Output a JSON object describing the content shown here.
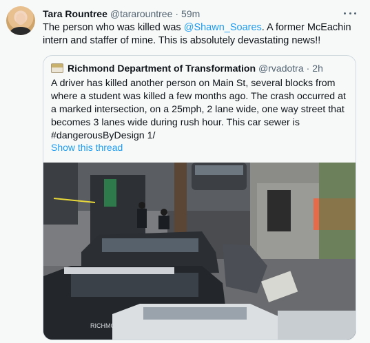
{
  "tweet": {
    "author_name": "Tara Rountree",
    "handle": "@tararountree",
    "separator": "·",
    "time": "59m",
    "text_before": "The person who was killed was ",
    "mention": "@Shawn_Soares",
    "text_after": ". A former McEachin intern and staffer of mine. This is absolutely devastating news!!"
  },
  "quoted": {
    "author_name": "Richmond Department of Transformation",
    "handle": "@rvadotra",
    "separator": "·",
    "time": "2h",
    "text": "A driver has killed another person on Main St, several blocks from where a student was killed a few months ago. The crash occurred at a marked intersection, on a 25mph, 2 lane wide, one way street that becomes 3 lanes wide during rush hour. This car sewer is #dangerousByDesign 1/",
    "show_thread": "Show this thread",
    "photo_car_text": "RICHMON"
  }
}
